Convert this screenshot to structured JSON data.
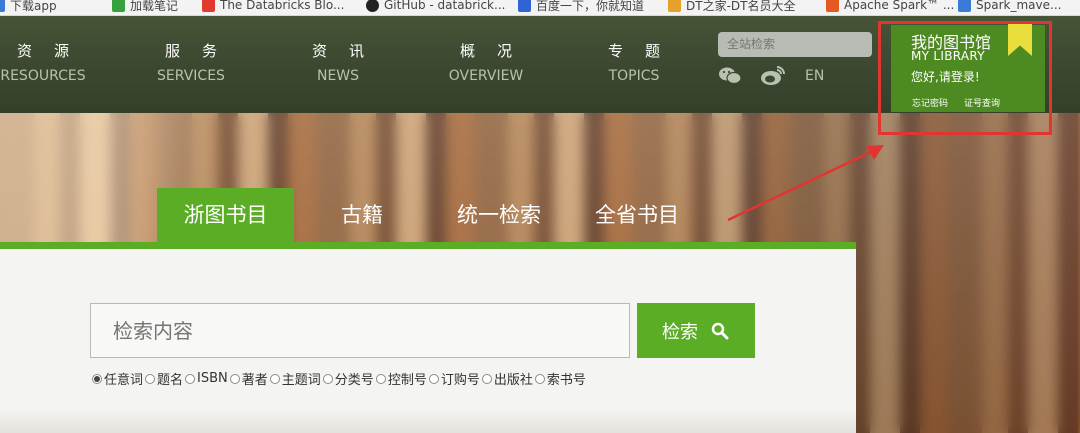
{
  "bookmarks": [
    {
      "label": "下载app",
      "color": "#3b7bd6"
    },
    {
      "label": "加载笔记",
      "color": "#35a13f"
    },
    {
      "label": "The Databricks Blo...",
      "color": "#e03a2f"
    },
    {
      "label": "GitHub - databrick...",
      "color": "#222222"
    },
    {
      "label": "百度一下，你就知道",
      "color": "#2f64d6"
    },
    {
      "label": "DT之家-DT名员大全",
      "color": "#e4a22a"
    },
    {
      "label": "Apache Spark™ ...",
      "color": "#e45a22"
    },
    {
      "label": "Spark_mave...",
      "color": "#3b7bd6"
    }
  ],
  "nav": {
    "items": [
      {
        "cn": "资源",
        "en": "RESOURCES"
      },
      {
        "cn": "服务",
        "en": "SERVICES"
      },
      {
        "cn": "资讯",
        "en": "NEWS"
      },
      {
        "cn": "概况",
        "en": "OVERVIEW"
      },
      {
        "cn": "专题",
        "en": "TOPICS"
      }
    ],
    "site_search_placeholder": "全站检索",
    "lang": "EN"
  },
  "my_library": {
    "title": "我的图书馆",
    "subtitle": "MY LIBRARY",
    "greeting": "您好,请登录!",
    "forgot_password": "忘记密码",
    "card_lookup": "证号查询"
  },
  "tabs": [
    {
      "label": "浙图书目",
      "active": true
    },
    {
      "label": "古籍",
      "active": false
    },
    {
      "label": "统一检索",
      "active": false
    },
    {
      "label": "全省书目",
      "active": false
    }
  ],
  "search": {
    "placeholder": "检索内容",
    "button_label": "检索",
    "options": [
      {
        "label": "任意词",
        "selected": true
      },
      {
        "label": "题名",
        "selected": false
      },
      {
        "label": "ISBN",
        "selected": false
      },
      {
        "label": "著者",
        "selected": false
      },
      {
        "label": "主题词",
        "selected": false
      },
      {
        "label": "分类号",
        "selected": false
      },
      {
        "label": "控制号",
        "selected": false
      },
      {
        "label": "订购号",
        "selected": false
      },
      {
        "label": "出版社",
        "selected": false
      },
      {
        "label": "索书号",
        "selected": false
      }
    ]
  },
  "colors": {
    "nav_bg": "#3b4730",
    "accent_green": "#5aad25",
    "library_green": "#4e8a22",
    "annotation_red": "#e03530",
    "ribbon_yellow": "#e8df3c"
  }
}
